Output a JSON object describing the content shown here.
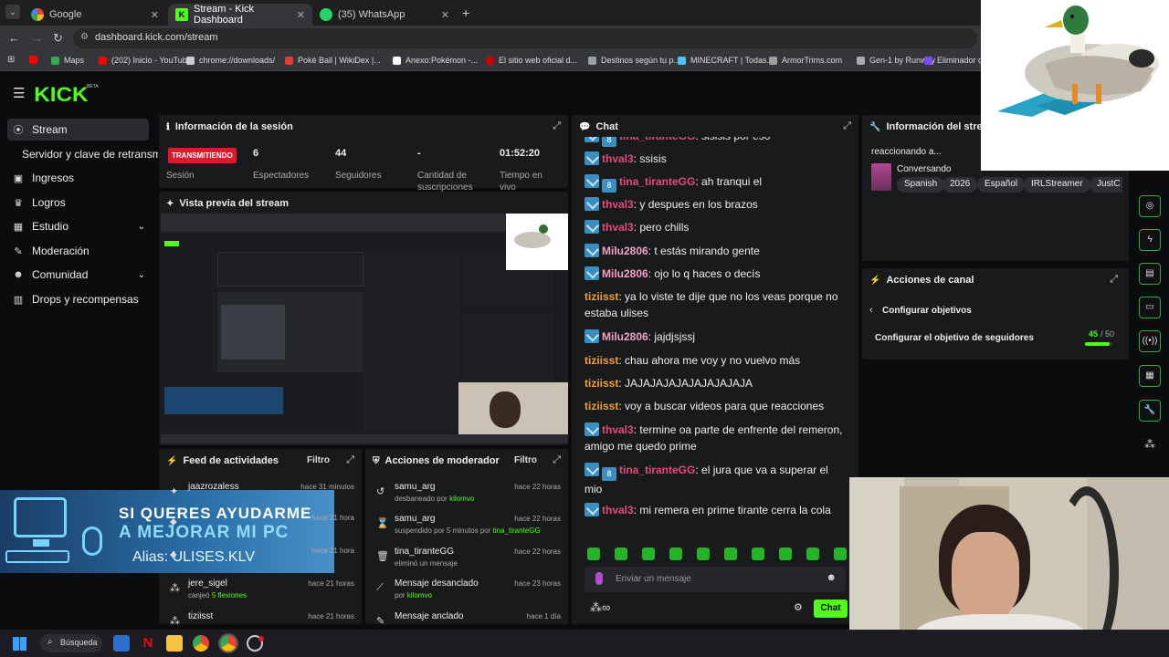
{
  "browser": {
    "tabs": [
      {
        "label": "Google",
        "icon": "google-icon"
      },
      {
        "label": "Stream - Kick Dashboard",
        "icon": "kick-icon"
      },
      {
        "label": "(35) WhatsApp",
        "icon": "whatsapp-icon"
      }
    ],
    "url": "dashboard.kick.com/stream",
    "bookmarks": [
      {
        "label": "",
        "color": "#ff0000"
      },
      {
        "label": "Maps",
        "color": "#34a853"
      },
      {
        "label": "(202) Inicio - YouTube",
        "color": "#ff0000"
      },
      {
        "label": "chrome://downloads/",
        "color": "#cccccc"
      },
      {
        "label": "Poké Ball | WikiDex |...",
        "color": "#e53935"
      },
      {
        "label": "Anexo:Pokémon -...",
        "color": "#ffffff"
      },
      {
        "label": "El sitio web oficial d...",
        "color": "#cc0000"
      },
      {
        "label": "Destinos según tu p...",
        "color": "#9aa0a6"
      },
      {
        "label": "MINECRAFT | Todas...",
        "color": "#4fc3f7"
      },
      {
        "label": "ArmorTrims.com",
        "color": "#9e9e9e"
      },
      {
        "label": "Gen-1 by Runway",
        "color": "#aaaaaa"
      },
      {
        "label": "Eliminador de...",
        "color": "#7c4dff"
      }
    ]
  },
  "kick": {
    "logo": "KICK",
    "beta": "BETA",
    "sidebar": [
      {
        "label": "Stream",
        "icon": "broadcast-icon",
        "active": true
      },
      {
        "label": "Servidor y clave de retransmisión",
        "icon": "",
        "active": false
      },
      {
        "label": "Ingresos",
        "icon": "money-icon",
        "active": false
      },
      {
        "label": "Logros",
        "icon": "trophy-icon",
        "active": false
      },
      {
        "label": "Estudio",
        "icon": "studio-icon",
        "active": false,
        "chevron": true
      },
      {
        "label": "Moderación",
        "icon": "wrench-icon",
        "active": false
      },
      {
        "label": "Comunidad",
        "icon": "community-icon",
        "active": false,
        "chevron": true
      },
      {
        "label": "Drops y recompensas",
        "icon": "gift-icon",
        "active": false
      }
    ],
    "session": {
      "title": "Información de la sesión",
      "status": "TRANSMITIENDO",
      "status_label": "Sesión",
      "stats": [
        {
          "value": "6",
          "label": "Espectadores"
        },
        {
          "value": "44",
          "label": "Seguidores"
        },
        {
          "value": "-",
          "label": "Cantidad de suscripciones"
        },
        {
          "value": "01:52:20",
          "label": "Tiempo en vivo"
        }
      ]
    },
    "preview": {
      "title": "Vista previa del stream"
    },
    "overlay": {
      "line1": "SI QUERES AYUDARME",
      "line2": "A MEJORAR MI PC",
      "alias": "Alias: ULISES.KLV"
    },
    "feed": {
      "title": "Feed de actividades",
      "filter": "Filtro",
      "rows": [
        {
          "name": "jaazrozaless",
          "sub": "",
          "time": "hace 31 minutos"
        },
        {
          "name": "",
          "sub": "",
          "time": "hace 21 hora"
        },
        {
          "name": "",
          "sub": "",
          "time": "hace 21 hora"
        },
        {
          "name": "jere_sigel",
          "sub": "canjeó",
          "sub_hl": "5 flexiones",
          "time": "hace 21 horas"
        },
        {
          "name": "tiziisst",
          "sub": "",
          "time": "hace 21 horas"
        }
      ]
    },
    "modactions": {
      "title": "Acciones de moderador",
      "filter": "Filtro",
      "rows": [
        {
          "name": "samu_arg",
          "sub": "desbaneado por",
          "sub_hl": "kilomvo",
          "time": "hace 22 horas",
          "icon": "unban-icon"
        },
        {
          "name": "samu_arg",
          "sub": "suspendido por 5 minutos por",
          "sub_hl": "tina_tiranteGG",
          "time": "hace 22 horas",
          "icon": "hourglass-icon"
        },
        {
          "name": "tina_tiranteGG",
          "sub": "eliminó un mensaje",
          "sub_hl": "",
          "time": "hace 22 horas",
          "icon": "trash-icon"
        },
        {
          "name": "Mensaje desanclado",
          "sub": "por",
          "sub_hl": "kilomvo",
          "time": "hace 23 horas",
          "icon": "unpin-icon"
        },
        {
          "name": "Mensaje anclado",
          "sub": "",
          "sub_hl": "",
          "time": "hace 1 día",
          "icon": "pin-icon"
        }
      ]
    },
    "chat": {
      "title": "Chat",
      "messages": [
        {
          "user": "tina_tiranteGG",
          "color": "#e64980",
          "badges": 2,
          "text": "sisisis por eso"
        },
        {
          "user": "thval3",
          "color": "#e64980",
          "badges": 1,
          "text": "ssisis"
        },
        {
          "user": "tina_tiranteGG",
          "color": "#e64980",
          "badges": 2,
          "text": "ah tranqui el"
        },
        {
          "user": "thval3",
          "color": "#e64980",
          "badges": 1,
          "text": "y despues en los brazos"
        },
        {
          "user": "thval3",
          "color": "#e64980",
          "badges": 1,
          "text": "pero chills"
        },
        {
          "user": "Milu2806",
          "color": "#f2a1c8",
          "badges": 1,
          "text": "t estás mirando gente"
        },
        {
          "user": "Milu2806",
          "color": "#f2a1c8",
          "badges": 1,
          "text": "ojo lo q haces o decís"
        },
        {
          "user": "tiziisst",
          "color": "#f0a030",
          "badges": 0,
          "text": "ya lo viste te dije que no los veas porque no estaba ulises"
        },
        {
          "user": "Milu2806",
          "color": "#f2a1c8",
          "badges": 1,
          "text": "jajdjsjssj"
        },
        {
          "user": "tiziisst",
          "color": "#f0a030",
          "badges": 0,
          "text": "chau ahora me voy y no vuelvo más"
        },
        {
          "user": "tiziisst",
          "color": "#f0a030",
          "badges": 0,
          "text": "JAJAJAJAJAJAJAJAJAJA"
        },
        {
          "user": "tiziisst",
          "color": "#f0a030",
          "badges": 0,
          "text": "voy a buscar videos para que reacciones"
        },
        {
          "user": "thval3",
          "color": "#e64980",
          "badges": 1,
          "text": "termine oa parte de enfrente del remeron, amigo me quedo prime"
        },
        {
          "user": "tina_tiranteGG",
          "color": "#e64980",
          "badges": 2,
          "text": "el jura que va a superar el mio"
        },
        {
          "user": "thval3",
          "color": "#e64980",
          "badges": 1,
          "text": "mi remera en prime tirante cerra la cola"
        }
      ],
      "placeholder": "Enviar un mensaje",
      "send": "Chat"
    },
    "streaminfo": {
      "title": "Información del stream",
      "stream_title": "reaccionando a...",
      "category": "Conversando",
      "tags": [
        "Spanish",
        "2026",
        "Español",
        "IRLStreamer",
        "JustC"
      ]
    },
    "channel": {
      "title": "Acciones de canal",
      "back": "Configurar objetivos",
      "goal": "Configurar el objetivo de seguidores",
      "progress_current": "45",
      "progress_total": "/ 50",
      "progress_fraction": 0.9
    }
  },
  "taskbar": {
    "search": "Búsqueda"
  }
}
